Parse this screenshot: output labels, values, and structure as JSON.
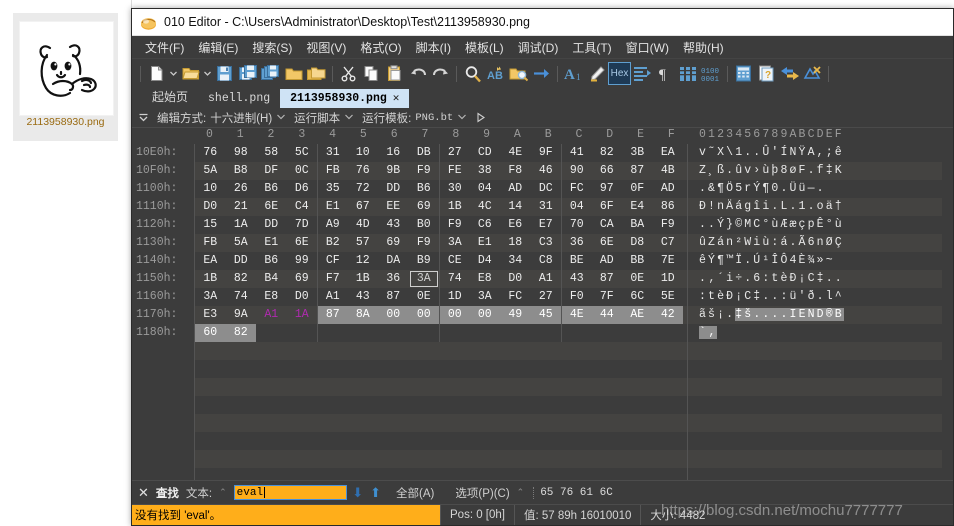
{
  "explorer": {
    "file_name": "2113958930.png",
    "thumbnail_alt": "cartoon-bear-drawing"
  },
  "window": {
    "title": "010 Editor - C:\\Users\\Administrator\\Desktop\\Test\\2113958930.png",
    "app_icon": "010-editor-icon"
  },
  "menu": [
    {
      "label": "文件(F)"
    },
    {
      "label": "编辑(E)"
    },
    {
      "label": "搜索(S)"
    },
    {
      "label": "视图(V)"
    },
    {
      "label": "格式(O)"
    },
    {
      "label": "脚本(I)"
    },
    {
      "label": "模板(L)"
    },
    {
      "label": "调试(D)"
    },
    {
      "label": "工具(T)"
    },
    {
      "label": "窗口(W)"
    },
    {
      "label": "帮助(H)"
    }
  ],
  "toolbar": {
    "icons": [
      "new-file-icon",
      "open-folder-icon",
      "save-icon",
      "save-as-icon",
      "save-all-icon",
      "folder-icon",
      "folders-icon",
      "cut-icon",
      "copy-icon",
      "paste-icon",
      "undo-icon",
      "redo-icon",
      "find-icon",
      "replace-icon",
      "find-in-files-icon",
      "goto-icon",
      "font-icon",
      "highlight-icon",
      "hex-toggle-icon",
      "indent-icon",
      "paragraph-icon",
      "columns-icon",
      "binary-icon",
      "calculator-icon",
      "inspector-icon",
      "compare-icon",
      "checksum-icon"
    ],
    "hex_button_label": "Hex"
  },
  "tabs": [
    {
      "label": "起始页",
      "active": false,
      "closable": false,
      "mono": false
    },
    {
      "label": "shell.png",
      "active": false,
      "closable": false,
      "mono": true
    },
    {
      "label": "2113958930.png",
      "active": true,
      "closable": true,
      "mono": true,
      "close_label": "✕"
    }
  ],
  "subbar": {
    "edit_mode_label": "编辑方式:",
    "edit_mode_value": "十六进制(H)",
    "run_script_label": "运行脚本",
    "run_template_label": "运行模板:",
    "run_template_value": "PNG.bt",
    "play_icon": "play-triangle-icon",
    "collapse_icon": "collapse-icon"
  },
  "hex_view": {
    "column_headers": [
      "0",
      "1",
      "2",
      "3",
      "4",
      "5",
      "6",
      "7",
      "8",
      "9",
      "A",
      "B",
      "C",
      "D",
      "E",
      "F"
    ],
    "ascii_header": "0123456789ABCDEF",
    "rows": [
      {
        "address": "10E0h:",
        "bytes": [
          "76",
          "98",
          "58",
          "5C",
          "31",
          "10",
          "16",
          "DB",
          "27",
          "CD",
          "4E",
          "9F",
          "41",
          "82",
          "3B",
          "EA"
        ],
        "colors": [
          "w",
          "w",
          "w",
          "w",
          "w",
          "w",
          "w",
          "w",
          "w",
          "w",
          "w",
          "w",
          "w",
          "w",
          "w",
          "w"
        ],
        "selected": [],
        "cursor": -1,
        "ascii": "v˜X\\1..Û'ÍNŸA,;ê",
        "ascii_sel": [],
        "stripe": false
      },
      {
        "address": "10F0h:",
        "bytes": [
          "5A",
          "B8",
          "DF",
          "0C",
          "FB",
          "76",
          "9B",
          "F9",
          "FE",
          "38",
          "F8",
          "46",
          "90",
          "66",
          "87",
          "4B"
        ],
        "colors": [
          "w",
          "w",
          "w",
          "w",
          "w",
          "w",
          "w",
          "w",
          "w",
          "w",
          "w",
          "w",
          "w",
          "w",
          "w",
          "w"
        ],
        "selected": [],
        "cursor": -1,
        "ascii": "Z¸ß.ûv›ùþ8øF.f‡K",
        "ascii_sel": [],
        "stripe": true
      },
      {
        "address": "1100h:",
        "bytes": [
          "10",
          "26",
          "B6",
          "D6",
          "35",
          "72",
          "DD",
          "B6",
          "30",
          "04",
          "AD",
          "DC",
          "FC",
          "97",
          "0F",
          "AD"
        ],
        "colors": [
          "w",
          "w",
          "w",
          "w",
          "w",
          "w",
          "w",
          "w",
          "w",
          "w",
          "w",
          "w",
          "w",
          "w",
          "w",
          "w"
        ],
        "selected": [],
        "cursor": -1,
        "ascii": ".&¶Ö5rÝ¶0.­Üü—.­",
        "ascii_sel": [],
        "stripe": false
      },
      {
        "address": "1110h:",
        "bytes": [
          "D0",
          "21",
          "6E",
          "C4",
          "E1",
          "67",
          "EE",
          "69",
          "1B",
          "4C",
          "14",
          "31",
          "04",
          "6F",
          "E4",
          "86"
        ],
        "colors": [
          "w",
          "w",
          "w",
          "w",
          "w",
          "w",
          "w",
          "w",
          "w",
          "w",
          "w",
          "w",
          "w",
          "w",
          "w",
          "w"
        ],
        "selected": [],
        "cursor": -1,
        "ascii": "Ð!nÄágîi.L.1.oä†",
        "ascii_sel": [],
        "stripe": true
      },
      {
        "address": "1120h:",
        "bytes": [
          "15",
          "1A",
          "DD",
          "7D",
          "A9",
          "4D",
          "43",
          "B0",
          "F9",
          "C6",
          "E6",
          "E7",
          "70",
          "CA",
          "BA",
          "F9"
        ],
        "colors": [
          "w",
          "w",
          "w",
          "w",
          "w",
          "w",
          "w",
          "w",
          "w",
          "w",
          "w",
          "w",
          "w",
          "w",
          "w",
          "w"
        ],
        "selected": [],
        "cursor": -1,
        "ascii": "..Ý}©MC°ùÆæçpÊ°ù",
        "ascii_sel": [],
        "stripe": false
      },
      {
        "address": "1130h:",
        "bytes": [
          "FB",
          "5A",
          "E1",
          "6E",
          "B2",
          "57",
          "69",
          "F9",
          "3A",
          "E1",
          "18",
          "C3",
          "36",
          "6E",
          "D8",
          "C7"
        ],
        "colors": [
          "w",
          "w",
          "w",
          "w",
          "w",
          "w",
          "w",
          "w",
          "w",
          "w",
          "w",
          "w",
          "w",
          "w",
          "w",
          "w"
        ],
        "selected": [],
        "cursor": -1,
        "ascii": "ûZán²Wiù:á.Ã6nØÇ",
        "ascii_sel": [],
        "stripe": true
      },
      {
        "address": "1140h:",
        "bytes": [
          "EA",
          "DD",
          "B6",
          "99",
          "CF",
          "12",
          "DA",
          "B9",
          "CE",
          "D4",
          "34",
          "C8",
          "BE",
          "AD",
          "BB",
          "7E"
        ],
        "colors": [
          "w",
          "w",
          "w",
          "w",
          "w",
          "w",
          "w",
          "w",
          "w",
          "w",
          "w",
          "w",
          "w",
          "w",
          "w",
          "w"
        ],
        "selected": [],
        "cursor": -1,
        "ascii": "êÝ¶™Ï.Ú¹ÎÔ4È¾­»~",
        "ascii_sel": [],
        "stripe": false
      },
      {
        "address": "1150h:",
        "bytes": [
          "1B",
          "82",
          "B4",
          "69",
          "F7",
          "1B",
          "36",
          "3A",
          "74",
          "E8",
          "D0",
          "A1",
          "43",
          "87",
          "0E",
          "1D"
        ],
        "colors": [
          "w",
          "w",
          "w",
          "w",
          "w",
          "w",
          "w",
          "w",
          "w",
          "w",
          "w",
          "w",
          "w",
          "w",
          "w",
          "w"
        ],
        "selected": [],
        "cursor": 7,
        "ascii": ".‚´i÷.6:tèÐ¡C‡..",
        "ascii_sel": [],
        "stripe": true
      },
      {
        "address": "1160h:",
        "bytes": [
          "3A",
          "74",
          "E8",
          "D0",
          "A1",
          "43",
          "87",
          "0E",
          "1D",
          "3A",
          "FC",
          "27",
          "F0",
          "7F",
          "6C",
          "5E"
        ],
        "colors": [
          "w",
          "w",
          "w",
          "w",
          "w",
          "w",
          "w",
          "w",
          "w",
          "w",
          "w",
          "w",
          "w",
          "w",
          "w",
          "w"
        ],
        "selected": [],
        "cursor": -1,
        "ascii": ":tèÐ¡C‡..:ü'ð.l^",
        "ascii_sel": [],
        "stripe": false
      },
      {
        "address": "1170h:",
        "bytes": [
          "E3",
          "9A",
          "A1",
          "1A",
          "87",
          "8A",
          "00",
          "00",
          "00",
          "00",
          "49",
          "45",
          "4E",
          "44",
          "AE",
          "42"
        ],
        "colors": [
          "w",
          "w",
          "m",
          "m",
          "m",
          "m",
          "w",
          "w",
          "w",
          "w",
          "b",
          "b",
          "b",
          "b",
          "m",
          "m"
        ],
        "selected": [
          4,
          5,
          6,
          7,
          8,
          9,
          10,
          11,
          12,
          13,
          14,
          15
        ],
        "cursor": -1,
        "ascii": "ãš¡.‡š....IEND®B",
        "ascii_sel": [
          4,
          16
        ],
        "stripe": true
      },
      {
        "address": "1180h:",
        "bytes": [
          "60",
          "82"
        ],
        "colors": [
          "m",
          "m"
        ],
        "selected": [
          0,
          1
        ],
        "cursor": -1,
        "ascii": "`‚",
        "ascii_sel": [
          0,
          2
        ],
        "stripe": false
      }
    ]
  },
  "find_bar": {
    "close_label": "✕",
    "title": "查找",
    "text_label": "文本:",
    "search_value": "eval",
    "find_next_icon": "arrow-down-icon",
    "find_prev_icon": "arrow-up-icon",
    "find_all_label": "全部(A)",
    "options_label": "选项(P)(C)",
    "hex_representation": "65 76 61 6C"
  },
  "status_bar": {
    "message": "没有找到 'eval'。",
    "position": "Pos: 0 [0h]",
    "value": "值: 57 89h 16010010",
    "size": "大小: 4482",
    "watermark": "https://blog.csdn.net/mochu7777777"
  },
  "colors": {
    "window_chrome": "#3c3c3c",
    "accent_orange": "#ffae1a",
    "accent_blue": "#4a90d9",
    "hex_blue": "#2b4ee0",
    "hex_magenta": "#b02ab0",
    "selection_gray": "#8d8d8d",
    "tab_active_bg": "#cfe3f5"
  }
}
